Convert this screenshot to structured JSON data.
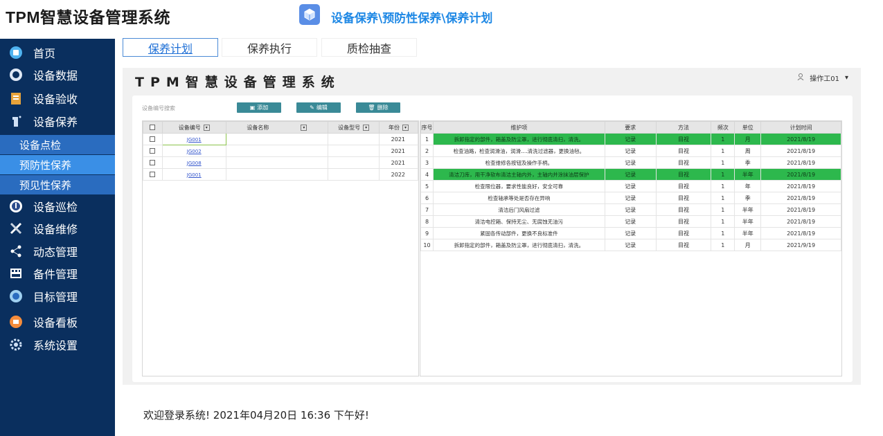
{
  "app": {
    "title": "TPM智慧设备管理系统"
  },
  "breadcrumb": "设备保养\\预防性保养\\保养计划",
  "sidebar": {
    "items": [
      {
        "label": "首页",
        "icon": "home-icon"
      },
      {
        "label": "设备数据",
        "icon": "data-icon"
      },
      {
        "label": "设备验收",
        "icon": "clipboard-icon"
      },
      {
        "label": "设备保养",
        "icon": "spray-icon"
      }
    ],
    "sub_items": [
      "设备点检",
      "预防性保养",
      "预见性保养"
    ],
    "items_after": [
      {
        "label": "设备巡检",
        "icon": "inspection-icon"
      },
      {
        "label": "设备维修",
        "icon": "tools-icon"
      },
      {
        "label": "动态管理",
        "icon": "share-icon"
      },
      {
        "label": "备件管理",
        "icon": "grid-icon"
      },
      {
        "label": "目标管理",
        "icon": "target-icon"
      },
      {
        "label": "设备看板",
        "icon": "board-icon"
      },
      {
        "label": "系统设置",
        "icon": "gear-icon"
      }
    ]
  },
  "tabs": [
    "保养计划",
    "保养执行",
    "质检抽查"
  ],
  "panel": {
    "title": "TPM智慧设备管理系统",
    "user": "操作工01",
    "search_label": "设备编号搜索",
    "buttons": {
      "add": "添加",
      "edit": "编辑",
      "delete": "删除"
    }
  },
  "left_table": {
    "headers": [
      "设备编号",
      "设备名称",
      "设备型号",
      "年份"
    ],
    "rows": [
      {
        "code": "JG001",
        "name": "",
        "model": "",
        "year": "2021"
      },
      {
        "code": "JG002",
        "name": "",
        "model": "",
        "year": "2021"
      },
      {
        "code": "JG008",
        "name": "",
        "model": "",
        "year": "2021"
      },
      {
        "code": "JG001",
        "name": "",
        "model": "",
        "year": "2022"
      }
    ]
  },
  "right_table": {
    "headers": [
      "序号",
      "维护项",
      "要求",
      "方法",
      "频次",
      "单位",
      "计划时间"
    ],
    "rows": [
      {
        "no": "1",
        "item": "拆卸指定的部件，箱盖及防尘罩，进行彻底清扫，清洗。",
        "req": "记录",
        "method": "目视",
        "freq": "1",
        "unit": "月",
        "time": "2021/8/19",
        "hl": true
      },
      {
        "no": "2",
        "item": "检查油路，检查润滑油，润滑....清洗过滤器，更换油毡。",
        "req": "记录",
        "method": "目视",
        "freq": "1",
        "unit": "周",
        "time": "2021/8/19",
        "hl": false
      },
      {
        "no": "3",
        "item": "检查维修各按钮及操作手柄。",
        "req": "记录",
        "method": "目视",
        "freq": "1",
        "unit": "季",
        "time": "2021/8/19",
        "hl": false
      },
      {
        "no": "4",
        "item": "清洁刀库，用干净软布清洁主轴内外，主轴内并涂抹油层保护",
        "req": "记录",
        "method": "目视",
        "freq": "1",
        "unit": "半年",
        "time": "2021/8/19",
        "hl": true
      },
      {
        "no": "5",
        "item": "检查限位器，要求性能良好，安全可靠",
        "req": "记录",
        "method": "目视",
        "freq": "1",
        "unit": "年",
        "time": "2021/8/19",
        "hl": false
      },
      {
        "no": "6",
        "item": "检查轴承等处是否存在异响",
        "req": "记录",
        "method": "目视",
        "freq": "1",
        "unit": "季",
        "time": "2021/8/19",
        "hl": false
      },
      {
        "no": "7",
        "item": "清洁后门风扇过滤",
        "req": "记录",
        "method": "目视",
        "freq": "1",
        "unit": "半年",
        "time": "2021/8/19",
        "hl": false
      },
      {
        "no": "8",
        "item": "清洁电控箱、保持无尘、无腐蚀无油污",
        "req": "记录",
        "method": "目视",
        "freq": "1",
        "unit": "半年",
        "time": "2021/8/19",
        "hl": false
      },
      {
        "no": "9",
        "item": "紧固各传动部件，更换不良标准件",
        "req": "记录",
        "method": "目视",
        "freq": "1",
        "unit": "半年",
        "time": "2021/8/19",
        "hl": false
      },
      {
        "no": "10",
        "item": "拆卸指定的部件，箱盖及防尘罩，进行彻底清扫，清洗。",
        "req": "记录",
        "method": "目视",
        "freq": "1",
        "unit": "月",
        "time": "2021/9/19",
        "hl": false
      }
    ]
  },
  "welcome": "欢迎登录系统!  2021年04月20日 16:36 下午好!"
}
